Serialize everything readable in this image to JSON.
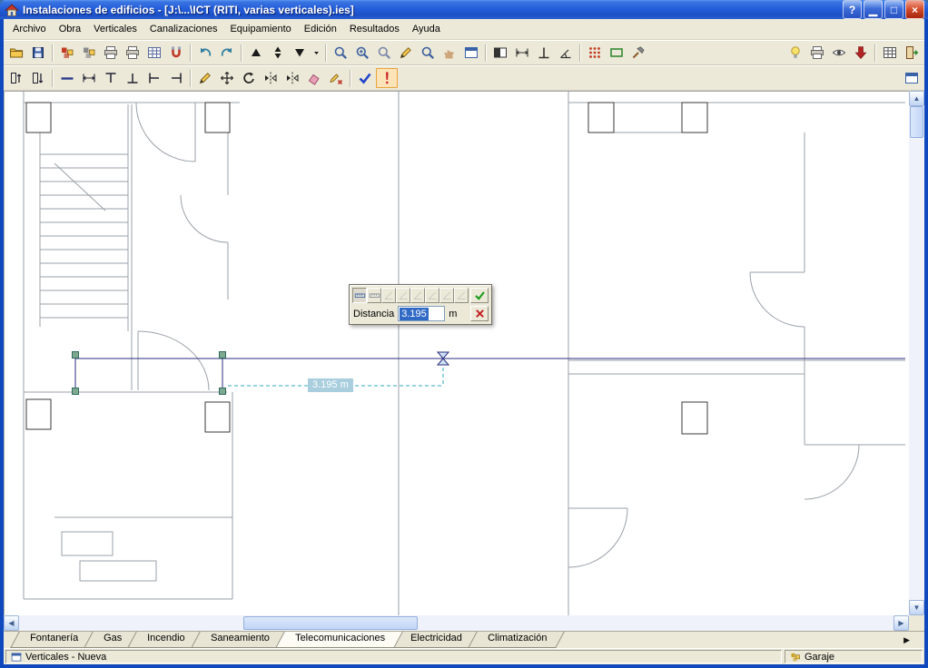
{
  "window": {
    "title": "Instalaciones de edificios - [J:\\...\\ICT (RITI, varias verticales).ies]",
    "controls": [
      {
        "name": "help-button",
        "glyph": "?",
        "kind": "blue"
      },
      {
        "name": "minimize-button",
        "glyph": "▁",
        "kind": "blue"
      },
      {
        "name": "restore-button",
        "glyph": "□",
        "kind": "blue"
      },
      {
        "name": "close-button",
        "glyph": "×",
        "kind": "red"
      }
    ]
  },
  "menu": {
    "items": [
      {
        "label": "Archivo",
        "name": "menu-archivo"
      },
      {
        "label": "Obra",
        "name": "menu-obra"
      },
      {
        "label": "Verticales",
        "name": "menu-verticales"
      },
      {
        "label": "Canalizaciones",
        "name": "menu-canalizaciones"
      },
      {
        "label": "Equipamiento",
        "name": "menu-equipamiento"
      },
      {
        "label": "Edición",
        "name": "menu-edicion"
      },
      {
        "label": "Resultados",
        "name": "menu-resultados"
      },
      {
        "label": "Ayuda",
        "name": "menu-ayuda"
      }
    ]
  },
  "toolbar_main": {
    "items": [
      {
        "kind": "btn",
        "name": "open-button",
        "icon": "folder-open-icon",
        "sym": "#sym-folder",
        "inter": "true"
      },
      {
        "kind": "btn",
        "name": "save-button",
        "icon": "floppy-icon",
        "sym": "#sym-floppy",
        "inter": "true"
      },
      {
        "kind": "sep",
        "name": "toolbar-separator",
        "inter": "false"
      },
      {
        "kind": "btn",
        "name": "job-new-button",
        "icon": "blocks-icon",
        "sym": "#sym-blocks",
        "color": "#C23B22",
        "inter": "true"
      },
      {
        "kind": "btn",
        "name": "job-manage-button",
        "icon": "blocks-icon",
        "sym": "#sym-blocks",
        "color": "#8A8A8A",
        "inter": "true"
      },
      {
        "kind": "btn",
        "name": "print-button",
        "icon": "printer-icon",
        "sym": "#sym-printer",
        "inter": "true"
      },
      {
        "kind": "btn",
        "name": "print-preview-button",
        "icon": "printer-icon",
        "sym": "#sym-printer",
        "inter": "true"
      },
      {
        "kind": "btn",
        "name": "templates-button",
        "icon": "grid-icon",
        "sym": "#sym-grid",
        "color": "#5A6B9E",
        "inter": "true"
      },
      {
        "kind": "btn",
        "name": "snap-magnet-button",
        "icon": "magnet-icon",
        "sym": "#sym-magnet",
        "inter": "true"
      },
      {
        "kind": "sep",
        "name": "toolbar-separator",
        "inter": "false"
      },
      {
        "kind": "btn",
        "name": "undo-button",
        "icon": "undo-arrow-icon",
        "sym": "#sym-undo",
        "color": "#2E7D9E",
        "inter": "true"
      },
      {
        "kind": "btn",
        "name": "redo-button",
        "icon": "redo-arrow-icon",
        "sym": "#sym-redo",
        "color": "#2E7D9E",
        "inter": "true"
      },
      {
        "kind": "sep",
        "name": "toolbar-separator",
        "inter": "false"
      },
      {
        "kind": "btn",
        "name": "plant-up-button",
        "icon": "triangle-up-icon",
        "sym": "#sym-tri-up",
        "color": "#1a1a1a",
        "inter": "true"
      },
      {
        "kind": "btn",
        "name": "plant-goto-button",
        "icon": "triangles-icon",
        "sym": "#sym-tri-both",
        "color": "#1a1a1a",
        "inter": "true"
      },
      {
        "kind": "btn",
        "name": "plant-down-button",
        "icon": "triangle-down-icon",
        "sym": "#sym-tri-down",
        "color": "#1a1a1a",
        "inter": "true"
      },
      {
        "kind": "btn",
        "state": "narrow",
        "name": "plant-menu-button",
        "icon": "caret-down-icon",
        "sym": "#sym-caret",
        "color": "#1a1a1a",
        "inter": "true"
      },
      {
        "kind": "sep",
        "name": "toolbar-separator",
        "inter": "false"
      },
      {
        "kind": "btn",
        "name": "zoom-window-button",
        "icon": "magnifier-icon",
        "sym": "#sym-zoom",
        "color": "#3A5F9E",
        "inter": "true"
      },
      {
        "kind": "btn",
        "name": "zoom-all-button",
        "icon": "magnifier-plus-icon",
        "sym": "#sym-zoom-plus",
        "color": "#3A5F9E",
        "inter": "true"
      },
      {
        "kind": "btn",
        "name": "zoom-previous-button",
        "icon": "magnifier-icon",
        "sym": "#sym-zoom",
        "color": "#7A87A8",
        "inter": "true"
      },
      {
        "kind": "btn",
        "name": "redraw-button",
        "icon": "pencil-icon",
        "sym": "#sym-pencil",
        "inter": "true"
      },
      {
        "kind": "btn",
        "name": "zoom-scale-button",
        "icon": "magnifier-icon",
        "sym": "#sym-zoom",
        "color": "#3A5F9E",
        "inter": "true"
      },
      {
        "kind": "btn",
        "name": "pan-button",
        "icon": "hand-icon",
        "sym": "#sym-hand",
        "color": "#C89B6C",
        "inter": "true"
      },
      {
        "kind": "btn",
        "name": "frame-view-button",
        "icon": "window-icon",
        "sym": "#sym-frame",
        "color": "#3A62A8",
        "inter": "true"
      },
      {
        "kind": "sep",
        "name": "toolbar-separator",
        "inter": "false"
      },
      {
        "kind": "btn",
        "name": "bw-view-button",
        "icon": "contrast-icon",
        "sym": "#sym-bw",
        "color": "#333333",
        "inter": "true"
      },
      {
        "kind": "btn",
        "name": "dimensions-button",
        "icon": "dimension-icon",
        "sym": "#sym-dim",
        "color": "#333333",
        "inter": "true"
      },
      {
        "kind": "btn",
        "name": "ortho-button",
        "icon": "perpendicular-icon",
        "sym": "#sym-perp",
        "color": "#333333",
        "inter": "true"
      },
      {
        "kind": "btn",
        "name": "measure-button",
        "icon": "angle-icon",
        "sym": "#sym-angle",
        "color": "#333333",
        "inter": "true"
      },
      {
        "kind": "sep",
        "name": "toolbar-separator",
        "inter": "false"
      },
      {
        "kind": "btn",
        "name": "references-button",
        "icon": "dots-grid-icon",
        "sym": "#sym-dots",
        "color": "#C23B22",
        "inter": "true"
      },
      {
        "kind": "btn",
        "name": "capture-region-button",
        "icon": "green-rect-icon",
        "sym": "#sym-rect-green",
        "color": "#3E8E3E",
        "inter": "true"
      },
      {
        "kind": "btn",
        "name": "tools-button",
        "icon": "hammer-icon",
        "sym": "#sym-hammer",
        "color": "#555555",
        "inter": "true"
      },
      {
        "kind": "spacer",
        "name": "toolbar-spacer",
        "inter": "false"
      },
      {
        "kind": "btn",
        "name": "lighting-options-button",
        "icon": "bulb-icon",
        "sym": "#sym-bulb",
        "inter": "true"
      },
      {
        "kind": "btn",
        "name": "print-plan-button",
        "icon": "printer-icon",
        "sym": "#sym-printer",
        "inter": "true"
      },
      {
        "kind": "btn",
        "name": "plan-preview-button",
        "icon": "eye-icon",
        "sym": "#sym-eye",
        "color": "#444444",
        "inter": "true"
      },
      {
        "kind": "btn",
        "name": "export-plan-button",
        "icon": "red-down-arrow-icon",
        "sym": "#sym-arrow-down-red",
        "color": "#B22222",
        "inter": "true"
      },
      {
        "kind": "sep",
        "name": "toolbar-separator",
        "inter": "false"
      },
      {
        "kind": "btn",
        "name": "report-tables-button",
        "icon": "grid-icon",
        "sym": "#sym-grid",
        "color": "#555555",
        "inter": "true"
      },
      {
        "kind": "btn",
        "name": "exit-button",
        "icon": "exit-door-icon",
        "sym": "#sym-exit",
        "inter": "true"
      }
    ]
  },
  "toolbar_edit": {
    "items": [
      {
        "kind": "btn",
        "name": "vertical-new-button",
        "icon": "riser-icon",
        "sym": "#sym-riser",
        "color": "#222233",
        "inter": "true"
      },
      {
        "kind": "btn",
        "name": "vertical-edit-button",
        "icon": "riser-arrows-icon",
        "sym": "#sym-riser2",
        "color": "#222233",
        "inter": "true"
      },
      {
        "kind": "sep",
        "name": "toolbar-separator",
        "inter": "false"
      },
      {
        "kind": "btn",
        "name": "conduit-button",
        "icon": "blue-line-icon",
        "sym": "#sym-line",
        "color": "#2B3C8F",
        "inter": "true"
      },
      {
        "kind": "btn",
        "name": "conduit-dim-button",
        "icon": "dimension-icon",
        "sym": "#sym-dim",
        "color": "#222233",
        "inter": "true"
      },
      {
        "kind": "btn",
        "name": "node-top-button",
        "icon": "tee-up-icon",
        "sym": "#sym-tee",
        "color": "#222233",
        "inter": "true"
      },
      {
        "kind": "btn",
        "name": "node-bottom-button",
        "icon": "tee-down-icon",
        "sym": "#sym-tee2",
        "color": "#222233",
        "inter": "true"
      },
      {
        "kind": "btn",
        "name": "node-left-button",
        "icon": "tee-left-icon",
        "sym": "#sym-tee3",
        "color": "#222233",
        "inter": "true"
      },
      {
        "kind": "btn",
        "name": "node-right-button",
        "icon": "tee-right-icon",
        "sym": "#sym-tee4",
        "color": "#222233",
        "inter": "true"
      },
      {
        "kind": "sep",
        "name": "toolbar-separator",
        "inter": "false"
      },
      {
        "kind": "btn",
        "name": "edit-element-button",
        "icon": "pencil-icon",
        "sym": "#sym-pencil",
        "inter": "true"
      },
      {
        "kind": "btn",
        "name": "move-element-button",
        "icon": "move-cross-icon",
        "sym": "#sym-move",
        "color": "#222222",
        "inter": "true"
      },
      {
        "kind": "btn",
        "name": "rotate-element-button",
        "icon": "rotate-icon",
        "sym": "#sym-rotate",
        "color": "#222222",
        "inter": "true"
      },
      {
        "kind": "btn",
        "name": "mirror-h-button",
        "icon": "mirror-icon",
        "sym": "#sym-mirror",
        "color": "#222222",
        "inter": "true"
      },
      {
        "kind": "btn",
        "name": "mirror-v-button",
        "icon": "mirror-icon",
        "sym": "#sym-mirror",
        "color": "#222222",
        "inter": "true"
      },
      {
        "kind": "btn",
        "name": "erase-button",
        "icon": "eraser-icon",
        "sym": "#sym-eraser",
        "inter": "true"
      },
      {
        "kind": "btn",
        "name": "edit-data-button",
        "icon": "pencil-x-icon",
        "sym": "#sym-pencil-x",
        "inter": "true"
      },
      {
        "kind": "sep",
        "name": "toolbar-separator",
        "inter": "false"
      },
      {
        "kind": "btn",
        "name": "check-design-button",
        "icon": "check-icon",
        "sym": "#sym-check",
        "color": "#2244CC",
        "inter": "true"
      },
      {
        "kind": "btn",
        "state": "warn",
        "name": "errors-button",
        "icon": "exclamation-icon",
        "sym": "#sym-exclaim",
        "color": "#CC2222",
        "inter": "true"
      },
      {
        "kind": "spacer",
        "name": "toolbar-spacer",
        "inter": "false"
      },
      {
        "kind": "btn",
        "name": "plan-config-button",
        "icon": "window-icon",
        "sym": "#sym-frame",
        "color": "#3A62A8",
        "inter": "true"
      }
    ]
  },
  "dialog": {
    "label": "Distancia",
    "value": "3.195",
    "unit": "m",
    "buttons": [
      {
        "name": "dim-orthogonal-button",
        "icon": "ruler-icon",
        "sym": "#sym-dlg-ruler",
        "color": "#3A62A8",
        "state": "pressed",
        "inter": "true"
      },
      {
        "name": "dim-aligned-button",
        "icon": "ruler-icon",
        "sym": "#sym-dlg-ruler",
        "color": "#7A8694",
        "inter": "true"
      },
      {
        "name": "dim-mode-3-button",
        "icon": "angle-icon",
        "sym": "#sym-dlg-angle",
        "color": "#98A0A8",
        "state": "disabled",
        "inter": "true"
      },
      {
        "name": "dim-mode-4-button",
        "icon": "angle-icon",
        "sym": "#sym-dlg-angle",
        "color": "#98A0A8",
        "state": "disabled",
        "inter": "true"
      },
      {
        "name": "dim-mode-5-button",
        "icon": "angle-icon",
        "sym": "#sym-dlg-angle",
        "color": "#98A0A8",
        "state": "disabled",
        "inter": "true"
      },
      {
        "name": "dim-mode-6-button",
        "icon": "angle-icon",
        "sym": "#sym-dlg-angle",
        "color": "#98A0A8",
        "state": "disabled",
        "inter": "true"
      },
      {
        "name": "dim-mode-7-button",
        "icon": "angle-icon",
        "sym": "#sym-dlg-angle",
        "color": "#98A0A8",
        "state": "disabled",
        "inter": "true"
      },
      {
        "name": "dim-mode-8-button",
        "icon": "angle-icon",
        "sym": "#sym-dlg-angle",
        "color": "#98A0A8",
        "state": "disabled",
        "inter": "true"
      }
    ]
  },
  "canvas": {
    "measure_label": "3.195 m"
  },
  "tabs": {
    "items": [
      {
        "label": "Fontanería",
        "name": "tab-fontaneria",
        "state": ""
      },
      {
        "label": "Gas",
        "name": "tab-gas",
        "state": ""
      },
      {
        "label": "Incendio",
        "name": "tab-incendio",
        "state": ""
      },
      {
        "label": "Saneamiento",
        "name": "tab-saneamiento",
        "state": ""
      },
      {
        "label": "Telecomunicaciones",
        "name": "tab-telecomunicaciones",
        "state": "active"
      },
      {
        "label": "Electricidad",
        "name": "tab-electricidad",
        "state": ""
      },
      {
        "label": "Climatización",
        "name": "tab-climatizacion",
        "state": ""
      }
    ],
    "overflow_glyph": "▶"
  },
  "scrollbar": {
    "up": "▲",
    "down": "▼",
    "left": "◀",
    "right": "▶"
  },
  "statusbar": {
    "left_text": "Verticales - Nueva",
    "right_text": "Garaje"
  },
  "colors": {
    "titlebar": "#245EDC",
    "window_border": "#1048BE",
    "toolbar_bg": "#ECE9D8",
    "selection_blue": "#316AC5",
    "measure_teal": "#2FA8C0",
    "pipe_navy": "#2B2E7F",
    "handle_green": "#7EA88F",
    "label_blue": "#A9CEDE",
    "warn_highlight": "#E8A33D"
  }
}
